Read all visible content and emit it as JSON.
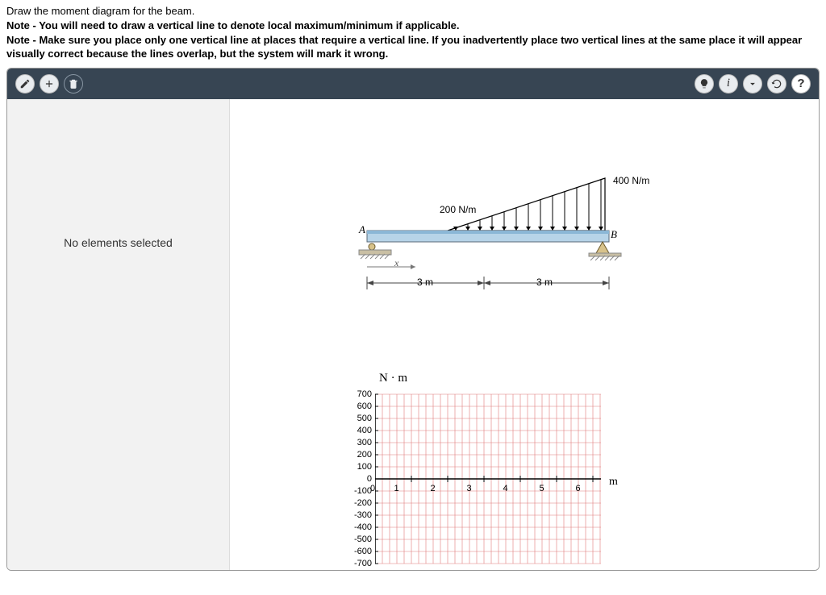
{
  "instruction": "Draw the moment diagram for the beam.",
  "notes": [
    "Note - You will need to draw a vertical line to denote local maximum/minimum if applicable.",
    "Note - Make sure you place only one vertical line at places that require a vertical line. If you inadvertently place two vertical lines at the same place it will appear visually correct because the lines overlap, but the system will mark it wrong."
  ],
  "panel": {
    "status": "No elements selected"
  },
  "beam": {
    "load_left_label": "200 N/m",
    "load_right_label": "400 N/m",
    "support_a": "A",
    "support_b": "B",
    "axis_var": "x",
    "span1": "3 m",
    "span2": "3 m"
  },
  "toolbar_icons": {
    "draw": "draw-tool",
    "add": "add-element",
    "delete": "delete-element",
    "hint": "hint",
    "info": "info",
    "collapse": "collapse",
    "reset": "reset",
    "help": "help"
  },
  "chart_data": {
    "type": "line",
    "title": "N · m",
    "xlabel": "m",
    "ylabel": "",
    "ylim": [
      -700,
      700
    ],
    "xlim": [
      0,
      6
    ],
    "y_ticks": [
      700,
      600,
      500,
      400,
      300,
      200,
      100,
      0,
      -100,
      -200,
      -300,
      -400,
      -500,
      -600,
      -700
    ],
    "x_ticks": [
      0,
      1,
      2,
      3,
      4,
      5,
      6
    ],
    "series": []
  }
}
